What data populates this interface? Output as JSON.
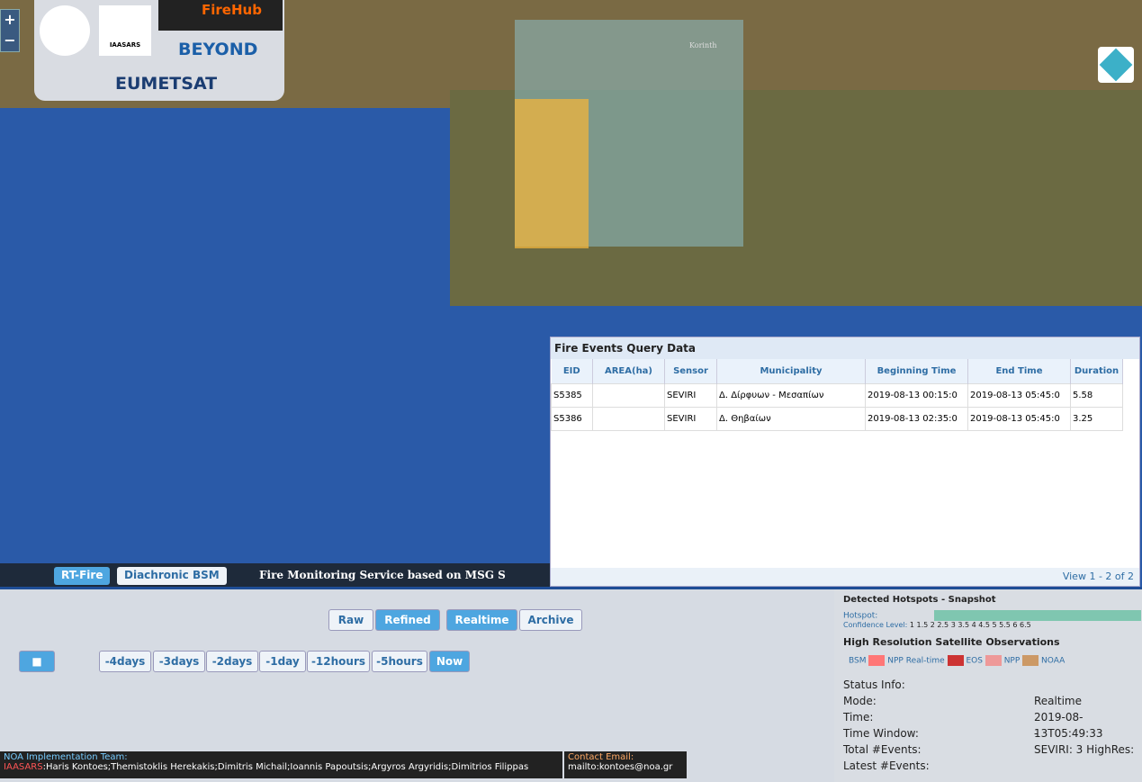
{
  "title": "Fire Monitoring Service based on MSG",
  "logos": {
    "firehub": "FireHub",
    "beyond": "BEYOND",
    "iaasars": "IAASARS",
    "eumetsat": "EUMETSAT"
  },
  "place": "Korinth",
  "panel": {
    "title": "Fire Events Query Data",
    "cols": [
      "EID",
      "AREA(ha)",
      "Sensor",
      "Municipality",
      "Beginning Time",
      "End Time",
      "Duration"
    ],
    "rows": [
      [
        "S5385",
        "",
        "SEVIRI",
        "Δ. Δίρφυων - Μεσαπίων",
        "2019-08-13 00:15:0",
        "2019-08-13 05:45:0",
        "5.58"
      ],
      [
        "S5386",
        "",
        "SEVIRI",
        "Δ. Θηβαίων",
        "2019-08-13 02:35:0",
        "2019-08-13 05:45:0",
        "3.25"
      ]
    ],
    "footer": "View 1 - 2 of 2"
  },
  "tabs": {
    "rt": "RT-Fire",
    "di": "Diachronic BSM",
    "banner": "Fire Monitoring Service based on MSG S"
  },
  "modes": [
    "Raw",
    "Refined",
    "Realtime",
    "Archive"
  ],
  "times": [
    "-4days",
    "-3days",
    "-2days",
    "-1day",
    "-12hours",
    "-5hours",
    "Now"
  ],
  "legend": {
    "title": "Detected Hotspots - Snapshot",
    "hot": "Hotspot:",
    "conf": "Confidence Level:",
    "levels": "1   1.5   2   2.5   3   3.5   4   4.5   5   5.5   6   6.5",
    "hr": "High Resolution Satellite Observations",
    "bsm": "BSM",
    "npp": "NPP",
    "rt": "Real-time",
    "eos": "EOS",
    "npp2": "NPP",
    "noaa": "NOAA"
  },
  "status": {
    "title": "Status Info:",
    "mode": "Mode:",
    "modev": "Realtime",
    "time": "Time:",
    "timev": "2019-08-13T05:49:33",
    "tw": "Time Window:",
    "twv": "-",
    "tot": "Total #Events:",
    "totv": "SEVIRI: 3  HighRes:",
    "lat": "Latest #Events:"
  },
  "team": {
    "t": "NOA Implementation Team:",
    "org": "IAASARS",
    "names": ":Haris Kontoes;Themistoklis Herekakis;Dimitris Michail;Ioannis Papoutsis;Argyros Argyridis;Dimitrios Filippas"
  },
  "mail": {
    "t": "Contact Email:",
    "v": "mailto:kontoes@noa.gr"
  },
  "colors": {
    "accent": "#2e6da4"
  }
}
